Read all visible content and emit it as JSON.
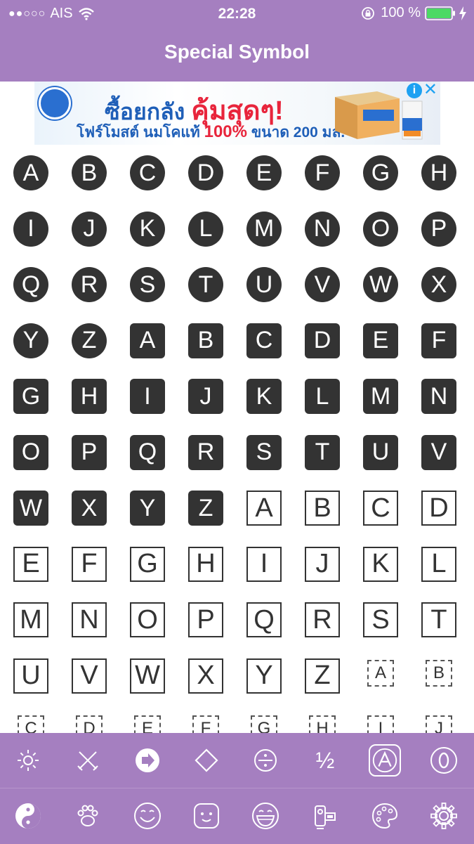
{
  "status_bar": {
    "signal": "●●○○○",
    "carrier": "AIS",
    "time": "22:28",
    "battery_percent": "100 %",
    "battery_level": 1.0
  },
  "nav": {
    "title": "Special Symbol"
  },
  "ad": {
    "headline_prefix": "ซื้อยกลัง",
    "headline_highlight": "คุ้มสุดๆ!",
    "sub_prefix": "โฟร์โมสต์ นมโคแท้",
    "sub_percent": "100%",
    "sub_suffix": "ขนาด 200 มล.",
    "info_label": "i",
    "close_label": "✕"
  },
  "symbols": {
    "circled_letters": [
      "A",
      "B",
      "C",
      "D",
      "E",
      "F",
      "G",
      "H",
      "I",
      "J",
      "K",
      "L",
      "M",
      "N",
      "O",
      "P",
      "Q",
      "R",
      "S",
      "T",
      "U",
      "V",
      "W",
      "X",
      "Y",
      "Z"
    ],
    "squared_filled_letters": [
      "A",
      "B",
      "C",
      "D",
      "E",
      "F",
      "G",
      "H",
      "I",
      "J",
      "K",
      "L",
      "M",
      "N",
      "O",
      "P",
      "Q",
      "R",
      "S",
      "T",
      "U",
      "V",
      "W",
      "X",
      "Y",
      "Z"
    ],
    "squared_outline_letters": [
      "A",
      "B",
      "C",
      "D",
      "E",
      "F",
      "G",
      "H",
      "I",
      "J",
      "K",
      "L",
      "M",
      "N",
      "O",
      "P",
      "Q",
      "R",
      "S",
      "T",
      "U",
      "V",
      "W",
      "X",
      "Y",
      "Z"
    ],
    "dashed_letters": [
      "A",
      "B",
      "C",
      "D",
      "E",
      "F",
      "G",
      "H",
      "I",
      "J"
    ]
  },
  "category_bar": {
    "items": [
      {
        "icon": "sun-icon"
      },
      {
        "icon": "crossed-swords-icon"
      },
      {
        "icon": "arrow-circle-icon"
      },
      {
        "icon": "diamond-icon"
      },
      {
        "icon": "divide-icon"
      },
      {
        "icon": "fraction-icon",
        "label": "½"
      },
      {
        "icon": "circled-a-icon",
        "label": "Ⓐ",
        "selected": true
      },
      {
        "icon": "circled-zero-icon",
        "label": "⓪"
      }
    ]
  },
  "tab_bar": {
    "items": [
      {
        "icon": "yin-yang-icon"
      },
      {
        "icon": "paw-icon"
      },
      {
        "icon": "smiley-icon"
      },
      {
        "icon": "square-face-icon"
      },
      {
        "icon": "grin-icon"
      },
      {
        "icon": "camcorder-icon"
      },
      {
        "icon": "palette-icon"
      },
      {
        "icon": "gear-icon"
      }
    ]
  },
  "colors": {
    "accent": "#a57fc0",
    "symbol_fill": "#333333",
    "ad_blue": "#1f5fb8",
    "ad_red": "#e8253c"
  }
}
